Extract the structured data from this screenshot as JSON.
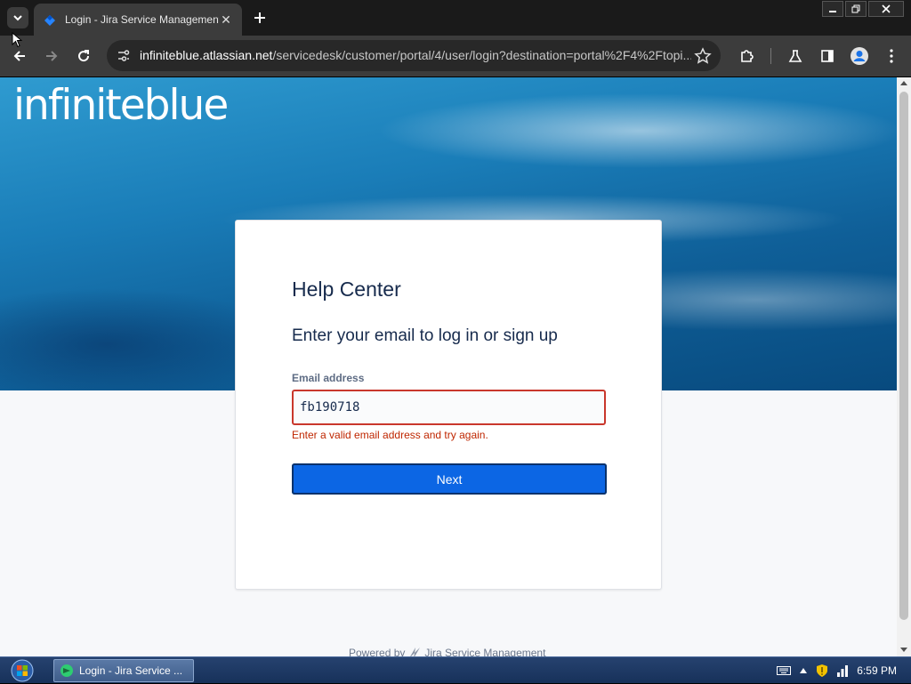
{
  "browser": {
    "tab_title": "Login - Jira Service Management",
    "url_host": "infiniteblue.atlassian.net",
    "url_path": "/servicedesk/customer/portal/4/user/login?destination=portal%2F4%2Ftopi..."
  },
  "page": {
    "logo_text": "infiniteblue",
    "card_title": "Help Center",
    "subtitle": "Enter your email to log in or sign up",
    "email_label": "Email address",
    "email_value": "fb190718",
    "error_message": "Enter a valid email address and try again.",
    "next_label": "Next",
    "powered_by_prefix": "Powered by",
    "powered_by_product": "Jira Service Management"
  },
  "taskbar": {
    "task_label": "Login - Jira Service ...",
    "clock": "6:59 PM"
  },
  "colors": {
    "accent": "#0c66e4",
    "error": "#c9372c",
    "text": "#172b4d"
  }
}
